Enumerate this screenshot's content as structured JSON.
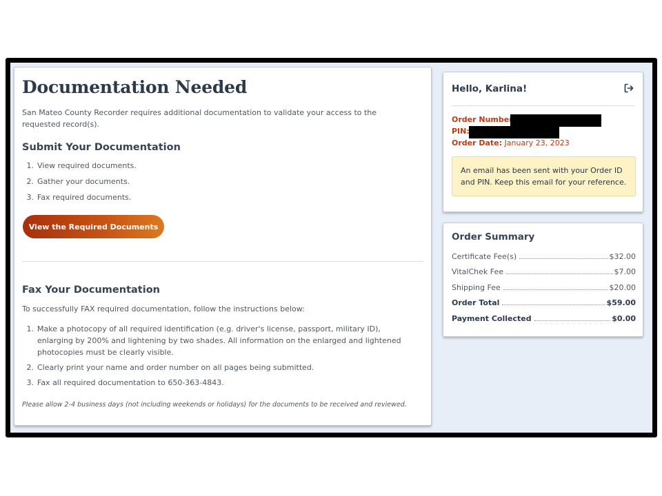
{
  "main": {
    "title": "Documentation Needed",
    "intro": "San Mateo County Recorder requires additional documentation to validate your access to the requested record(s).",
    "submit_heading": "Submit Your Documentation",
    "submit_steps": [
      {
        "num": "1.",
        "text": "View required documents."
      },
      {
        "num": "2.",
        "text": "Gather your documents."
      },
      {
        "num": "3.",
        "text": "Fax required documents."
      }
    ],
    "cta_label": "View the Required Documents",
    "fax_heading": "Fax Your Documentation",
    "fax_intro": "To successfully FAX required documentation, follow the instructions below:",
    "fax_steps": [
      {
        "num": "1.",
        "text": "Make a photocopy of all required identification (e.g. driver's license, passport, military ID), enlarging by 200% and lightening by two shades. All information on the enlarged and lightened photocopies must be clearly visible."
      },
      {
        "num": "2.",
        "text": "Clearly print your name and order number on all pages being submitted."
      },
      {
        "num": "3.",
        "text": "Fax all required documentation to 650-363-4843."
      }
    ],
    "fine_print": "Please allow 2-4 business days (not including weekends or holidays) for the documents to be received and reviewed."
  },
  "account": {
    "greeting": "Hello, Karlina!",
    "logout_icon": "sign-out-icon",
    "order_number_label": "Order Number:",
    "pin_label": "PIN:",
    "order_date_label": "Order Date:",
    "order_date_value": "January 23, 2023",
    "notice": "An email has been sent with your Order ID and PIN. Keep this email for your reference."
  },
  "summary": {
    "title": "Order Summary",
    "rows": [
      {
        "label": "Certificate Fee(s)",
        "value": "$32.00"
      },
      {
        "label": "VitalChek Fee",
        "value": "$7.00"
      },
      {
        "label": "Shipping Fee",
        "value": "$20.00"
      },
      {
        "label": "Order Total",
        "value": "$59.00"
      },
      {
        "label": "Payment Collected",
        "value": "$0.00"
      }
    ]
  },
  "colors": {
    "accent": "#bf3a12",
    "cta_gradient_start": "#a8300c",
    "cta_gradient_end": "#dc7920",
    "notice_background": "#fdf3c7",
    "frame_background": "#e8eef7"
  }
}
